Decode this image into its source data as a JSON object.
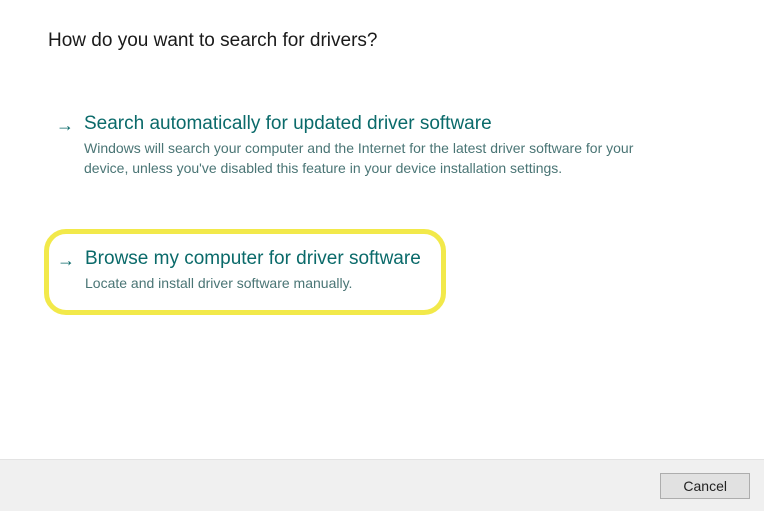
{
  "page_title": "How do you want to search for drivers?",
  "options": [
    {
      "title": "Search automatically for updated driver software",
      "description": "Windows will search your computer and the Internet for the latest driver software for your device, unless you've disabled this feature in your device installation settings.",
      "highlighted": false
    },
    {
      "title": "Browse my computer for driver software",
      "description": "Locate and install driver software manually.",
      "highlighted": true
    }
  ],
  "footer": {
    "cancel_label": "Cancel"
  }
}
